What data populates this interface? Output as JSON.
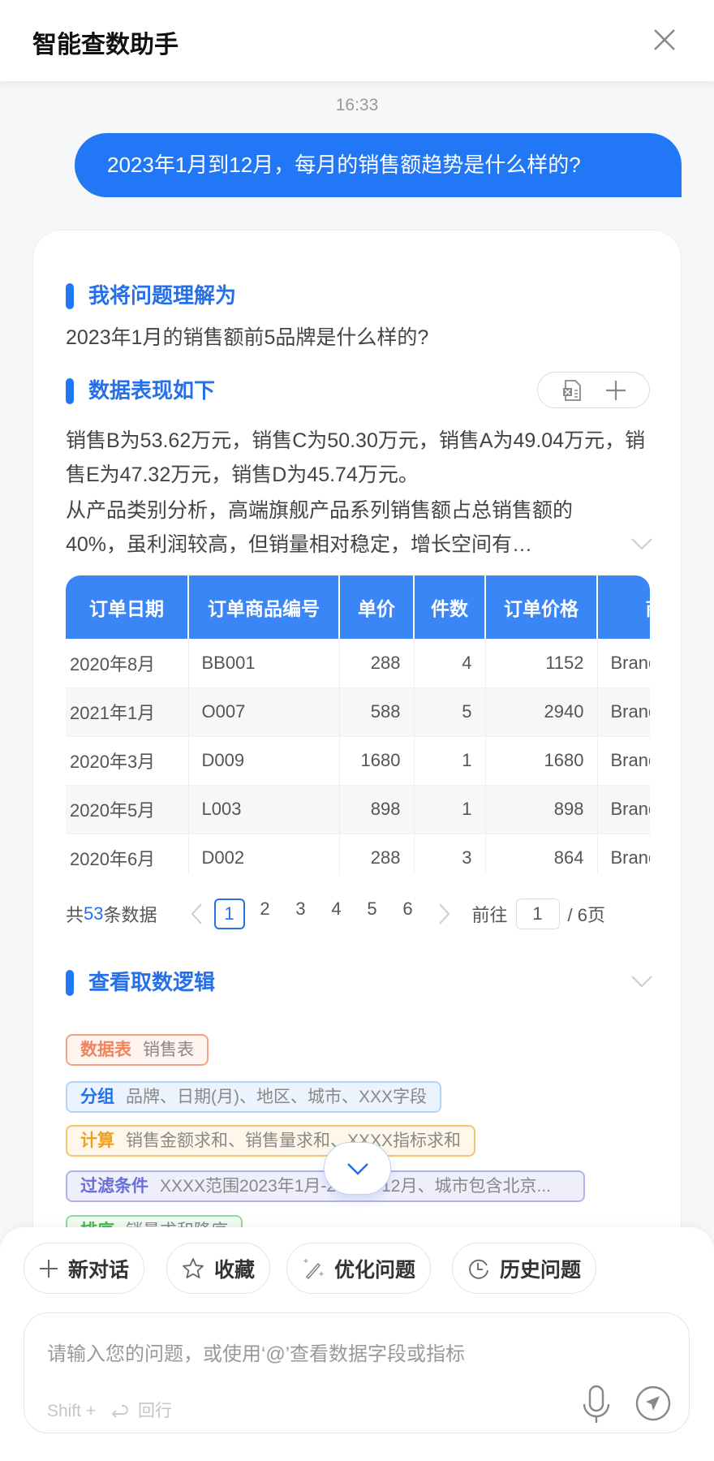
{
  "header": {
    "title": "智能查数助手",
    "close_icon": "close-icon"
  },
  "chat": {
    "time": "16:33",
    "user_message": "2023年1月到12月，每月的销售额趋势是什么样的?"
  },
  "answer": {
    "understand_title": "我将问题理解为",
    "understand_text": "2023年1月的销售额前5品牌是什么样的?",
    "data_title": "数据表现如下",
    "tool_icons": [
      "excel-export-icon",
      "plus-icon"
    ],
    "summary_1": "销售B为53.62万元，销售C为50.30万元，销售A为49.04万元，销售E为47.32万元，销售D为45.74万元。",
    "summary_2": "从产品类别分析，高端旗舰产品系列销售额占总销售额的40%，虽利润较高，但销量相对稳定，增长空间有…",
    "table": {
      "columns": [
        "订单日期",
        "订单商品编号",
        "单价",
        "件数",
        "订单价格",
        "商品"
      ],
      "rows": [
        [
          "2020年8月",
          "BB001",
          "288",
          "4",
          "1152",
          "Brand"
        ],
        [
          "2021年1月",
          "O007",
          "588",
          "5",
          "2940",
          "Brand"
        ],
        [
          "2020年3月",
          "D009",
          "1680",
          "1",
          "1680",
          "Brand"
        ],
        [
          "2020年5月",
          "L003",
          "898",
          "1",
          "898",
          "Brand"
        ],
        [
          "2020年6月",
          "D002",
          "288",
          "3",
          "864",
          "Brand"
        ]
      ]
    },
    "pager": {
      "prefix": "共",
      "total": "53",
      "suffix": "条数据",
      "pages": [
        "1",
        "2",
        "3",
        "4",
        "5",
        "6"
      ],
      "current": "1",
      "goto_label": "前往",
      "goto_value": "1",
      "total_pages": "/ 6页"
    },
    "logic_title": "查看取数逻辑",
    "tags": [
      {
        "label": "数据表",
        "value": "销售表",
        "color": "#f0845a"
      },
      {
        "label": "分组",
        "value": "品牌、日期(月)、地区、城市、XXX字段",
        "color": "#2570e8"
      },
      {
        "label": "计算",
        "value": "销售金额求和、销售量求和、XXXX指标求和",
        "color": "#f0a020"
      },
      {
        "label": "过滤条件",
        "value": "XXXX范围2023年1月-2023年12月、城市包含北京...",
        "color": "#6a6fd8"
      },
      {
        "label": "排序",
        "value": "销量求和降序",
        "color": "#46b956"
      }
    ]
  },
  "bottom": {
    "buttons": [
      "新对话",
      "收藏",
      "优化问题",
      "历史问题"
    ],
    "input_placeholder": "请输入您的问题，或使用‘@’查看数据字段或指标",
    "hint_shift": "Shift +",
    "hint_newline": "回行"
  },
  "colors": {
    "accent": "#2277f6",
    "table_header": "#3a86f7"
  }
}
